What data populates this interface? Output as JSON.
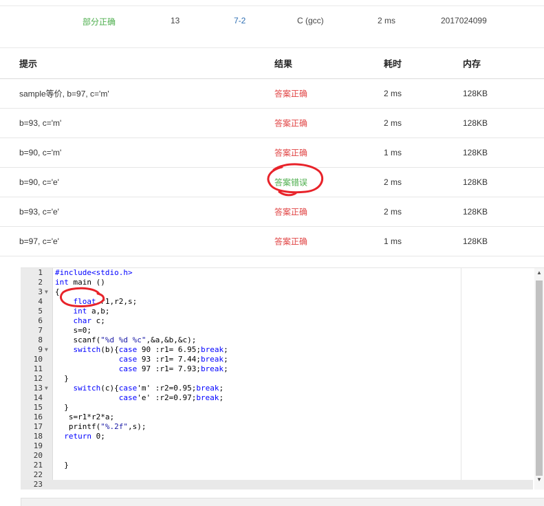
{
  "summary": {
    "status": "部分正确",
    "score": "13",
    "problem": "7-2",
    "compiler": "C (gcc)",
    "time": "2 ms",
    "user": "2017024099"
  },
  "results": {
    "headers": {
      "hint": "提示",
      "result": "结果",
      "time": "耗时",
      "memory": "内存"
    },
    "rows": [
      {
        "hint": "sample等价, b=97, c='m'",
        "result": "答案正确",
        "time": "2 ms",
        "memory": "128KB",
        "status": "correct"
      },
      {
        "hint": "b=93, c='m'",
        "result": "答案正确",
        "time": "2 ms",
        "memory": "128KB",
        "status": "correct"
      },
      {
        "hint": "b=90, c='m'",
        "result": "答案正确",
        "time": "1 ms",
        "memory": "128KB",
        "status": "correct"
      },
      {
        "hint": "b=90, c='e'",
        "result": "答案错误",
        "time": "2 ms",
        "memory": "128KB",
        "status": "wrong"
      },
      {
        "hint": "b=93, c='e'",
        "result": "答案正确",
        "time": "2 ms",
        "memory": "128KB",
        "status": "correct"
      },
      {
        "hint": "b=97, c='e'",
        "result": "答案正确",
        "time": "1 ms",
        "memory": "128KB",
        "status": "correct"
      }
    ]
  },
  "colors": {
    "correct": "#e04343",
    "wrong": "#4cae4c",
    "annotation": "#e8232a"
  },
  "code": {
    "lines": [
      {
        "n": "1",
        "text": "#include<stdio.h>",
        "fold": false
      },
      {
        "n": "2",
        "text": "int main ()",
        "fold": false
      },
      {
        "n": "3",
        "text": "{",
        "fold": true
      },
      {
        "n": "4",
        "text": "    float r1,r2,s;",
        "fold": false
      },
      {
        "n": "5",
        "text": "    int a,b;",
        "fold": false
      },
      {
        "n": "6",
        "text": "    char c;",
        "fold": false
      },
      {
        "n": "7",
        "text": "    s=0;",
        "fold": false
      },
      {
        "n": "8",
        "text": "    scanf(\"%d %d %c\",&a,&b,&c);",
        "fold": false
      },
      {
        "n": "9",
        "text": "    switch(b){case 90 :r1= 6.95;break;",
        "fold": true
      },
      {
        "n": "10",
        "text": "              case 93 :r1= 7.44;break;",
        "fold": false
      },
      {
        "n": "11",
        "text": "              case 97 :r1= 7.93;break;",
        "fold": false
      },
      {
        "n": "12",
        "text": "  }",
        "fold": false
      },
      {
        "n": "13",
        "text": "    switch(c){case'm' :r2=0.95;break;",
        "fold": true
      },
      {
        "n": "14",
        "text": "              case'e' :r2=0.97;break;",
        "fold": false
      },
      {
        "n": "15",
        "text": "  }",
        "fold": false
      },
      {
        "n": "16",
        "text": "   s=r1*r2*a;",
        "fold": false
      },
      {
        "n": "17",
        "text": "   printf(\"%.2f\",s);",
        "fold": false
      },
      {
        "n": "18",
        "text": "  return 0;",
        "fold": false
      },
      {
        "n": "19",
        "text": "",
        "fold": false
      },
      {
        "n": "20",
        "text": "",
        "fold": false
      },
      {
        "n": "21",
        "text": "  }",
        "fold": false
      },
      {
        "n": "22",
        "text": "",
        "fold": false
      },
      {
        "n": "23",
        "text": "",
        "fold": false
      }
    ],
    "active_line": "23"
  }
}
